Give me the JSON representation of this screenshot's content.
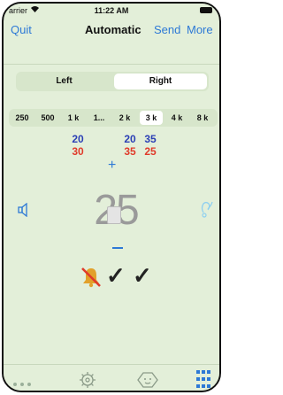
{
  "status": {
    "carrier": "arrier",
    "time": "11:22 AM"
  },
  "navbar": {
    "quit": "Quit",
    "title": "Automatic",
    "send": "Send",
    "more": "More"
  },
  "ear_selector": {
    "left": "Left",
    "right": "Right",
    "selected": "Right"
  },
  "frequencies": {
    "options": [
      "250",
      "500",
      "1 k",
      "1...",
      "2 k",
      "3 k",
      "4 k",
      "8 k"
    ],
    "selected": "3 k"
  },
  "thresholds": {
    "col_1k": {
      "blue": "20",
      "red": "30"
    },
    "col_2k": {
      "blue": "20",
      "red": "35"
    },
    "col_3k": {
      "blue": "35",
      "red": "25"
    }
  },
  "level": {
    "value": "25"
  },
  "responses": {
    "check_count": 2
  },
  "icons": {
    "speaker": "speaker-icon",
    "hearing": "hearing-aid-icon",
    "mute": "mute-bell-icon",
    "tabs": [
      "dots-icon",
      "settings-gear-icon",
      "baby-face-icon",
      "grid-icon"
    ]
  },
  "colors": {
    "accent": "#2d79d6",
    "background": "#e3efd9",
    "threshold_blue": "#2b3fb5",
    "threshold_red": "#e03a2a"
  }
}
